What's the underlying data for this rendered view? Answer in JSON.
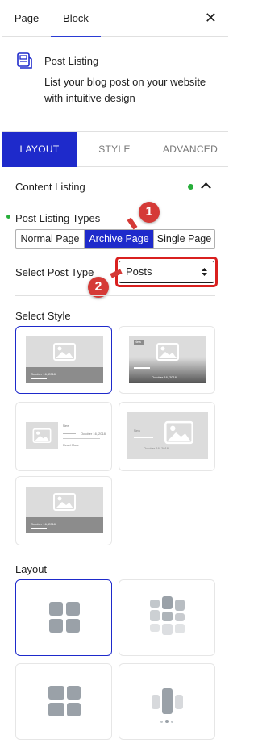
{
  "top_tabs": {
    "page": "Page",
    "block": "Block"
  },
  "block": {
    "title": "Post Listing",
    "description": "List your blog post on your website with intuitive design"
  },
  "tabs": {
    "layout": "LAYOUT",
    "style": "STYLE",
    "advanced": "ADVANCED"
  },
  "content_listing": {
    "title": "Content Listing"
  },
  "types": {
    "label": "Post Listing Types",
    "options": [
      "Normal Page",
      "Archive Page",
      "Single Page"
    ],
    "selected": "Archive Page"
  },
  "post_type": {
    "label": "Select Post Type",
    "value": "Posts"
  },
  "annotations": {
    "one": "1",
    "two": "2"
  },
  "select_style": {
    "label": "Select Style"
  },
  "style_card": {
    "date": "October 16, 2018",
    "new": "New",
    "read_more": "Read More"
  },
  "layout": {
    "label": "Layout"
  },
  "colors": {
    "accent": "#1e2acb",
    "annotation": "#d53a37",
    "status": "#27ae3a"
  }
}
